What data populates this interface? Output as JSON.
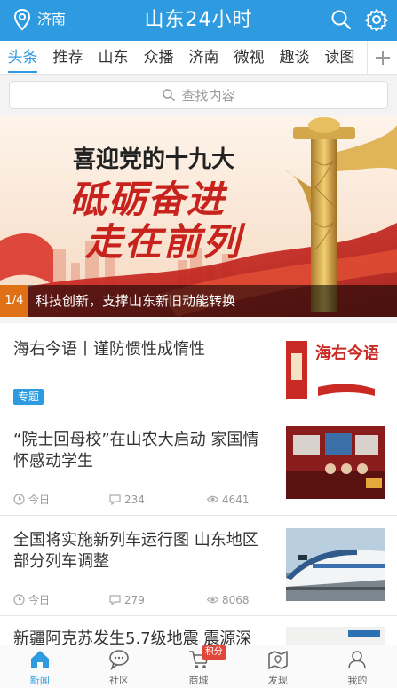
{
  "header": {
    "location": "济南",
    "title": "山东24小时"
  },
  "tabs": [
    "头条",
    "推荐",
    "山东",
    "众播",
    "济南",
    "微视",
    "趣谈",
    "读图"
  ],
  "search": {
    "placeholder": "查找内容"
  },
  "banner": {
    "text_line1": "喜迎党的十九大",
    "text_line2": "砥砺奋进",
    "text_line3": "走在前列",
    "page_indicator": "1/4",
    "caption": "科技创新，支撑山东新旧动能转换"
  },
  "news": [
    {
      "title": "海右今语丨谨防惯性成惰性",
      "tag": "专题",
      "thumb_text": "海右今语"
    },
    {
      "title": "“院士回母校”在山农大启动 家国情怀感动学生",
      "time": "今日",
      "comments": "234",
      "views": "4641"
    },
    {
      "title": "全国将实施新列车运行图 山东地区部分列车调整",
      "time": "今日",
      "comments": "279",
      "views": "8068"
    },
    {
      "title": "新疆阿克苏发生5.7级地震 震源深"
    }
  ],
  "bottom_nav": [
    {
      "label": "新闻",
      "icon": "home-icon"
    },
    {
      "label": "社区",
      "icon": "chat-bubble-icon"
    },
    {
      "label": "商城",
      "icon": "cart-icon",
      "badge": "积分"
    },
    {
      "label": "发现",
      "icon": "map-icon"
    },
    {
      "label": "我的",
      "icon": "user-icon"
    }
  ],
  "colors": {
    "brand": "#2e9be0",
    "banner_red": "#c8221d",
    "page_indicator": "#e07016"
  }
}
